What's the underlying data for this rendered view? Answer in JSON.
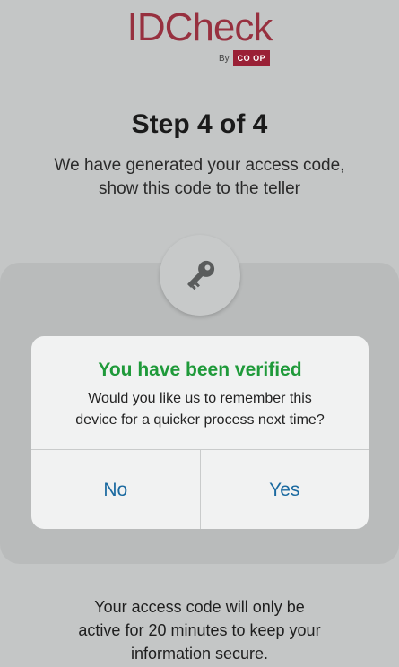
{
  "logo": {
    "title": "IDCheck",
    "by": "By",
    "brand": "CO OP"
  },
  "step": {
    "title": "Step 4 of 4",
    "description_lines": [
      "We have generated your access code,",
      "show this code to the teller"
    ]
  },
  "key_icon": "key-icon",
  "dialog": {
    "title": "You have been verified",
    "message_lines": [
      "Would you like us to remember this",
      "device for a quicker process next time?"
    ],
    "no_label": "No",
    "yes_label": "Yes"
  },
  "footer": {
    "lines": [
      "Your access code will only be",
      "active for 20 minutes to keep your",
      "information secure."
    ]
  },
  "colors": {
    "brand_red": "#97303f",
    "coop_badge": "#9a2036",
    "success_green": "#1f9a3a",
    "action_blue": "#1b6aa0",
    "backdrop": "#c4c6c6"
  }
}
